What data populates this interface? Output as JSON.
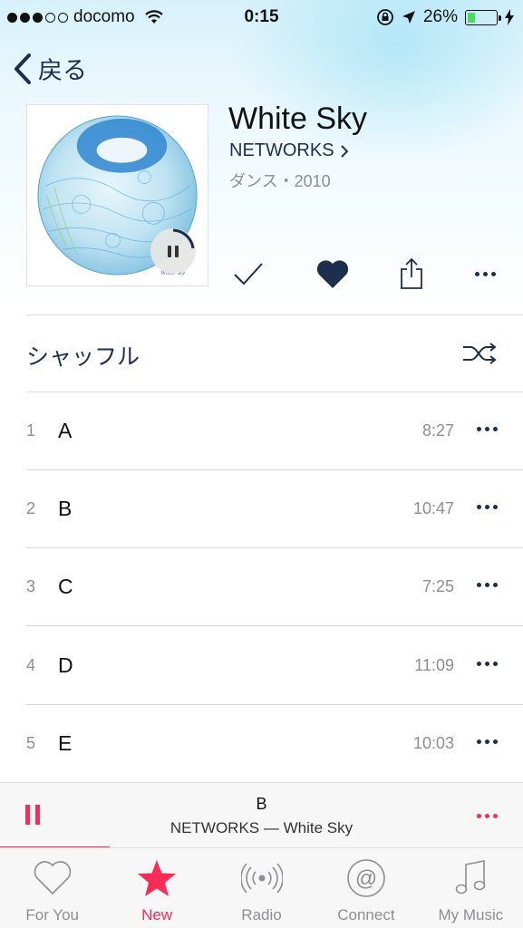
{
  "status_bar": {
    "carrier": "docomo",
    "time": "0:15",
    "battery": "26%",
    "battery_level": 0.26
  },
  "nav": {
    "back_label": "戻る"
  },
  "album": {
    "title": "White Sky",
    "artist": "NETWORKS",
    "meta": "ダンス・2010",
    "art_caption": "White sky"
  },
  "shuffle": {
    "label": "シャッフル"
  },
  "tracks": [
    {
      "number": "1",
      "name": "A",
      "duration": "8:27"
    },
    {
      "number": "2",
      "name": "B",
      "duration": "10:47"
    },
    {
      "number": "3",
      "name": "C",
      "duration": "7:25"
    },
    {
      "number": "4",
      "name": "D",
      "duration": "11:09"
    },
    {
      "number": "5",
      "name": "E",
      "duration": "10:03"
    }
  ],
  "now_playing": {
    "title": "B",
    "subtitle": "NETWORKS — White Sky",
    "progress": 0.21
  },
  "tabs": [
    {
      "label": "For You",
      "icon": "heart-icon",
      "active": false
    },
    {
      "label": "New",
      "icon": "star-icon",
      "active": true
    },
    {
      "label": "Radio",
      "icon": "radio-icon",
      "active": false
    },
    {
      "label": "Connect",
      "icon": "at-icon",
      "active": false
    },
    {
      "label": "My Music",
      "icon": "music-note-icon",
      "active": false
    }
  ],
  "colors": {
    "accent": "#fb2b57",
    "navy": "#1e2e4e",
    "secondary_text": "#8e8e93"
  }
}
